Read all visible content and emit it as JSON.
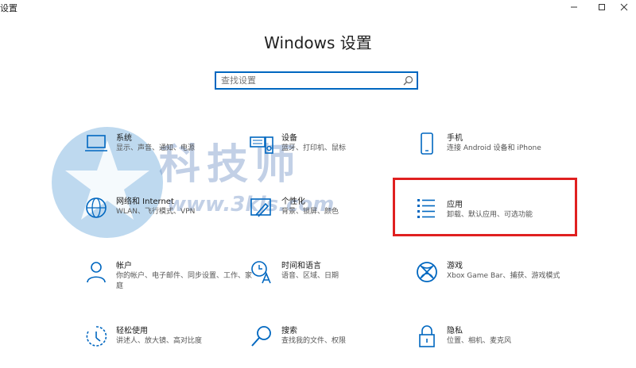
{
  "window": {
    "title": "设置",
    "controls": [
      "minimize-icon",
      "maximize-icon",
      "close-icon"
    ]
  },
  "header": {
    "title": "Windows 设置"
  },
  "search": {
    "placeholder": "查找设置",
    "icon": "search-icon"
  },
  "watermark": {
    "text": "科技师",
    "url": "www.3kjs.com"
  },
  "colors": {
    "accent": "#0067c0",
    "highlight_border": "#e02020"
  },
  "tiles": [
    {
      "name": "系统",
      "desc": "显示、声音、通知、电源",
      "icon": "laptop-icon"
    },
    {
      "name": "设备",
      "desc": "蓝牙、打印机、鼠标",
      "icon": "keyboard-speaker-icon"
    },
    {
      "name": "手机",
      "desc": "连接 Android 设备和 iPhone",
      "icon": "phone-icon"
    },
    {
      "name": "网络和 Internet",
      "desc": "WLAN、飞行模式、VPN",
      "icon": "globe-icon"
    },
    {
      "name": "个性化",
      "desc": "背景、锁屏、颜色",
      "icon": "paint-icon"
    },
    {
      "name": "应用",
      "desc": "卸载、默认应用、可选功能",
      "icon": "apps-list-icon",
      "highlighted": true
    },
    {
      "name": "帐户",
      "desc": "你的帐户、电子邮件、同步设置、工作、家庭",
      "icon": "person-icon"
    },
    {
      "name": "时间和语言",
      "desc": "语音、区域、日期",
      "icon": "time-language-icon"
    },
    {
      "name": "游戏",
      "desc": "Xbox Game Bar、捕获、游戏模式",
      "icon": "xbox-icon"
    },
    {
      "name": "轻松使用",
      "desc": "讲述人、放大镜、高对比度",
      "icon": "ease-of-access-icon"
    },
    {
      "name": "搜索",
      "desc": "查找我的文件、权限",
      "icon": "search-icon"
    },
    {
      "name": "隐私",
      "desc": "位置、相机、麦克风",
      "icon": "lock-icon"
    }
  ]
}
